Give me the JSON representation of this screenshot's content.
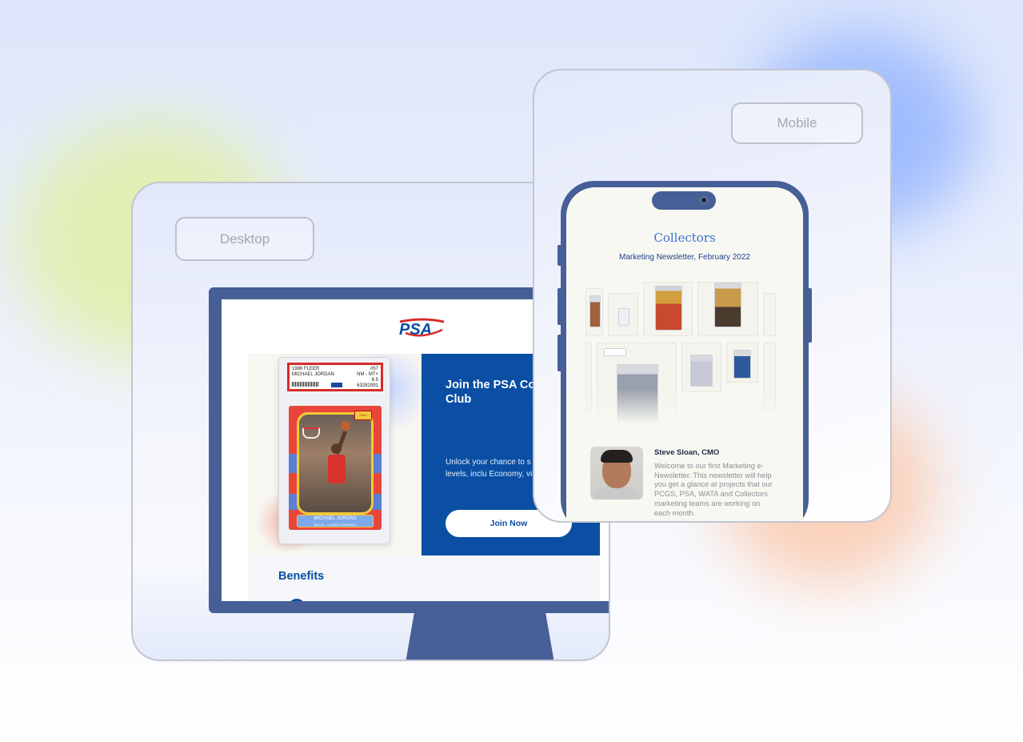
{
  "desktop_section": {
    "label": "Desktop",
    "logo_text": "PSA",
    "card": {
      "label_left_line1": "1986 FLEER",
      "label_left_line2": "MICHAEL JORDAN",
      "label_right_line1": "#57",
      "label_right_line2": "NM - MT+",
      "label_right_line3": "8.5",
      "label_right_line4": "63282991",
      "brand_tag": "Fleer",
      "nameplate": "MICHAEL JORDAN",
      "nameplate_sub": "BULLS · GUARD-FORWARD"
    },
    "hero": {
      "title": "Join the PSA Collectors Club",
      "text": "Unlock your chance to s PSA service levels, inclu Economy, via PSA Subm",
      "button_label": "Join Now"
    },
    "benefits_title": "Benefits"
  },
  "mobile_section": {
    "label": "Mobile",
    "brand": "Collectors",
    "subtitle": "Marketing Newsletter, February 2022",
    "author": "Steve Sloan, CMO",
    "intro": "Welcome to our first Marketing e-Newsletter. This newsletter will help you get a glance at projects that our PCGS, PSA, WATA and Collectors marketing teams are working on each month."
  },
  "colors": {
    "device": "#465f96",
    "psa_blue": "#0a4fa3",
    "psa_red": "#d62c2c",
    "collectors_blue": "#3a6fd6"
  }
}
